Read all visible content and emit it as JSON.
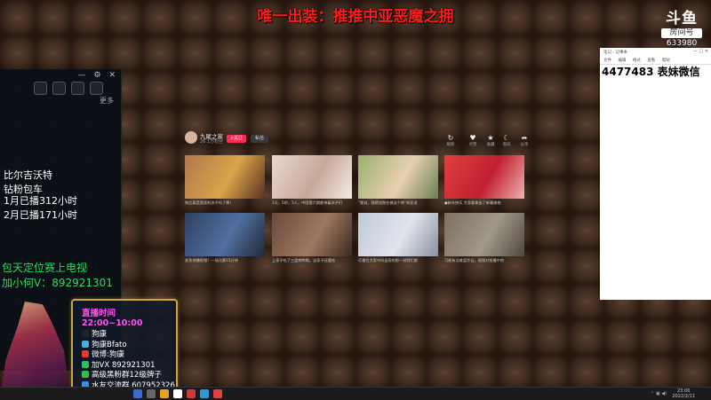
{
  "banner": "唯一出装：推推中亚恶魔之拥",
  "douyu": {
    "logo": "斗鱼",
    "room_label": "房间号",
    "room_number": "633980"
  },
  "left_panel": {
    "controls": [
      "—",
      "⚙",
      "✕"
    ],
    "more_label": "更多",
    "white_lines": [
      "比尔吉沃特",
      "钻粉包车",
      "1月已播312小时",
      "2月已播171小时"
    ],
    "green_lines": [
      "包天定位赛上电视",
      "加小何V：892921301"
    ]
  },
  "infobox": {
    "time": "直播时间 22:00~10:00",
    "rows": [
      {
        "icon": "tiktok-icon",
        "color": "#222222",
        "text": "狗康"
      },
      {
        "icon": "bilibili-icon",
        "color": "#4aa8e0",
        "text": "狗康Bfato"
      },
      {
        "icon": "weibo-icon",
        "color": "#e23b2e",
        "text": "微博:狗康"
      },
      {
        "icon": "wechat-icon",
        "color": "#2fbf55",
        "text": "加VX 892921301"
      },
      {
        "icon": "fan-group-icon",
        "color": "#2fbf55",
        "text": "高级黑粉群12级牌子"
      },
      {
        "icon": "qq-icon",
        "color": "#3b8ee0",
        "text": "水友交流群 607952326"
      }
    ]
  },
  "video_window": {
    "channel_name": "九尾之家",
    "channel_sub": "26.1万粉丝",
    "follow_label": "+关注",
    "message_label": "私信",
    "actions": [
      {
        "icon": "refresh-icon",
        "glyph": "↻",
        "label": "刷新"
      },
      {
        "icon": "like-icon",
        "glyph": "♥",
        "label": "点赞"
      },
      {
        "icon": "star-icon",
        "glyph": "★",
        "label": "收藏"
      },
      {
        "icon": "moon-icon",
        "glyph": "☾",
        "label": "夜间"
      },
      {
        "icon": "share-icon",
        "glyph": "➦",
        "label": "分享"
      }
    ],
    "thumbs": [
      {
        "caption": "狗比真是我家的孩子吗了啊！",
        "colors": [
          "#b07850",
          "#d9a44a",
          "#5a3020"
        ]
      },
      {
        "caption": "1天，5秒，5人，中国第六期都带着孩子们",
        "colors": [
          "#e8d8d0",
          "#c8a898",
          "#f4ece8"
        ]
      },
      {
        "caption": "\"我说，我感觉狗在做这个吧\"你还说",
        "colors": [
          "#9ab070",
          "#e8d0b0",
          "#6a8050"
        ]
      },
      {
        "caption": "●新年快乐 大家都拿出了新春旗袍",
        "colors": [
          "#e04040",
          "#c02030",
          "#f0b0b0"
        ]
      },
      {
        "caption": "紧急地播视频！一场比赛15分钟",
        "colors": [
          "#304060",
          "#5070a0",
          "#202838"
        ]
      },
      {
        "caption": "上家子吃了三盘烤鸭哦，这家子还要吃",
        "colors": [
          "#6a4a3a",
          "#a07860",
          "#3a2a20"
        ]
      },
      {
        "caption": "尽量在大家中间出现的那一刻我们都",
        "colors": [
          "#c0c8d8",
          "#e0e4ec",
          "#8890a0"
        ]
      },
      {
        "caption": "可能有点难度作业，视频对拍摄中的",
        "colors": [
          "#807060",
          "#a09888",
          "#504840"
        ]
      }
    ]
  },
  "notepad": {
    "title": "笔记 - 记事本",
    "controls": "— □ ✕",
    "menu": [
      "文件",
      "编辑",
      "格式",
      "查看",
      "帮助"
    ],
    "text": "4477483 表妹微信"
  },
  "taskbar": {
    "apps": [
      "#3a6ad0",
      "#666666",
      "#e8a020",
      "#ffffff",
      "#d03a3a",
      "#2a9ad0",
      "#e04040"
    ],
    "time": "23:00",
    "date": "2022/2/11"
  }
}
